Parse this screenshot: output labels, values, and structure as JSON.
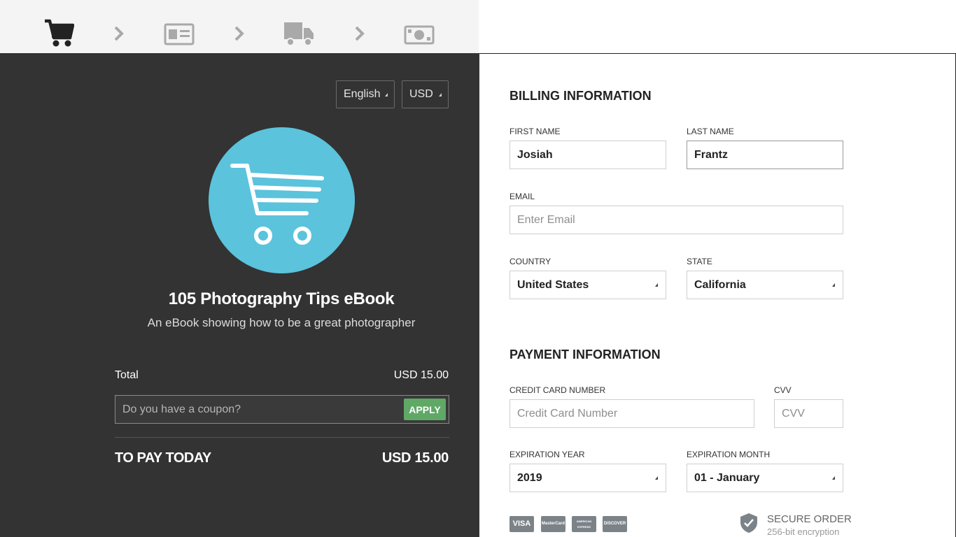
{
  "steps": [
    {
      "icon": "cart-icon",
      "active": true
    },
    {
      "icon": "id-card-icon",
      "active": false
    },
    {
      "icon": "truck-icon",
      "active": false
    },
    {
      "icon": "money-icon",
      "active": false
    }
  ],
  "colors": {
    "dark_panel": "#333333",
    "hero": "#5bc3dc",
    "apply": "#5fa866",
    "inactive_step": "#a9a9a9"
  },
  "summary": {
    "language": "English",
    "currency": "USD",
    "product_title": "105 Photography Tips eBook",
    "product_subtitle": "An eBook showing how to be a great photographer",
    "total_label": "Total",
    "total_value": "USD 15.00",
    "coupon_placeholder": "Do you have a coupon?",
    "apply_label": "APPLY",
    "pay_today_label": "TO PAY TODAY",
    "pay_today_value": "USD 15.00"
  },
  "billing": {
    "title": "BILLING INFORMATION",
    "first_name_label": "FIRST NAME",
    "first_name_value": "Josiah",
    "last_name_label": "LAST NAME",
    "last_name_value": "Frantz",
    "email_label": "EMAIL",
    "email_placeholder": "Enter Email",
    "country_label": "COUNTRY",
    "country_value": "United States",
    "state_label": "STATE",
    "state_value": "California"
  },
  "payment": {
    "title": "PAYMENT INFORMATION",
    "card_number_label": "CREDIT CARD NUMBER",
    "card_number_placeholder": "Credit Card Number",
    "cvv_label": "CVV",
    "cvv_placeholder": "CVV",
    "exp_year_label": "EXPIRATION YEAR",
    "exp_year_value": "2019",
    "exp_month_label": "EXPIRATION MONTH",
    "exp_month_value": "01 - January",
    "cards": [
      "VISA",
      "MasterCard",
      "AMERICAN EXPRESS",
      "DISCOVER"
    ],
    "secure_title": "SECURE ORDER",
    "secure_sub": "256-bit encryption"
  }
}
